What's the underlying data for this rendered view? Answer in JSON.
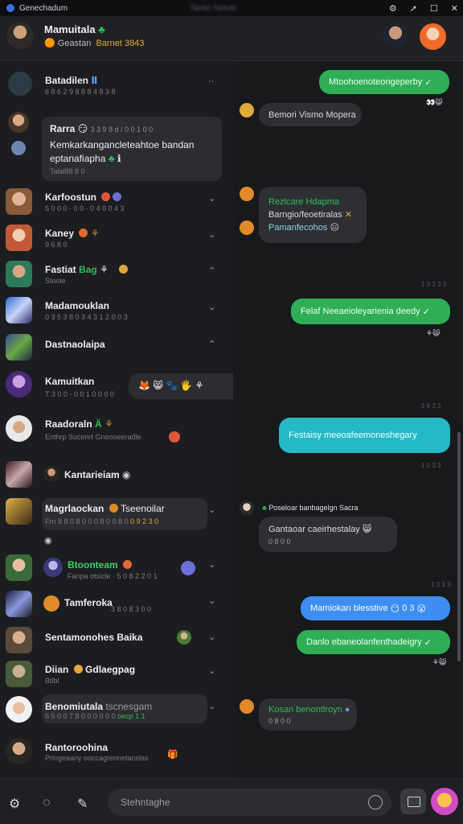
{
  "window": {
    "title": "Genechadum",
    "blurred_center": "Tantie Netute"
  },
  "header": {
    "name": "Mamuitala",
    "name_badge": "♣",
    "status": "Geastan",
    "status_note": "Barnet 3843"
  },
  "conversations": [
    {
      "title": "Batadilen",
      "tag": "Ⅱ",
      "meta": "6 8 6 2 9 8 8 8 4 8 3 8",
      "type": "group"
    },
    {
      "title": "Rarra",
      "time": "3 3 9 8 d / 0 0 1 0 0",
      "text1": "Kemkarkangancleteahtoe bandan",
      "text2": "eptanafiapha",
      "meta": "Talal88 8 0"
    },
    {
      "title": "Karfoostun",
      "meta": "5 0 0 0 - 0 0 - 0 4 0 0 4 3"
    },
    {
      "title": "Kaney",
      "meta": "9 6 8 0"
    },
    {
      "title": "Fastiat",
      "highlight": "Bag",
      "meta": "Stoole"
    },
    {
      "title": "Madamouklan",
      "meta": "0 3 5 3 8 0 3 4 3 1 2 0 0 3"
    },
    {
      "title": "Dastnaolaipa",
      "meta": ""
    },
    {
      "title": "Kamuitkan",
      "meta": "T 3 0 0 - 0 0 1 0 0 0 0",
      "reactions": "🦊 😸 🐾 🖐 ⚘"
    },
    {
      "title": "Raadoraln",
      "highlight": "Ä",
      "meta": "Enthrp Sucenrt Gneooeeradle"
    },
    {
      "title": "Kantarieiam",
      "meta": ""
    },
    {
      "title": "Magrlaockan",
      "extra": "Tseenoilar",
      "meta": "Frn 8 8 0 8 0 0 0 8 0 0 8 0",
      "meta_accent": "0 9 2 3 0"
    },
    {
      "title": "Btoonteam",
      "meta": "Fanpa otsicle · 5 0 8 2 2 0 1"
    },
    {
      "title": "Tamferoka",
      "meta": "3 8 0 8 3 0 0"
    },
    {
      "title": "Sentamonohes Baika",
      "meta": ""
    },
    {
      "title": "Diian",
      "extra": "Gdlaegpag",
      "meta": "Btlbl"
    },
    {
      "title": "Benomiutala",
      "extra": "tscnesgam",
      "meta": "5 5 0 0 7 8 0 0 0 0 0 0",
      "meta_accent": "oecp 1 1"
    },
    {
      "title": "Rantoroohina",
      "meta": "Pringeaany ooccagreonetacelas"
    }
  ],
  "messages": [
    {
      "text": "Mtoohoenoteongeperby",
      "style": "green",
      "check": "✓"
    },
    {
      "text": "Bemori Vismo Mopera",
      "style": "gray"
    },
    {
      "line1": "Rezlcare Hdapma",
      "line2": "Barngio/feoetiralas",
      "line3": "Pamanfecohos",
      "style": "gray"
    },
    {
      "text": "Felaf Neeaeioleyarienia deedy",
      "style": "green",
      "check": "✓",
      "time": "3 8 3 3"
    },
    {
      "text": "Festaisy meeoafeemoneshegary",
      "style": "teal",
      "time": "3 8 3 3"
    },
    {
      "sender": "Poseloar banbagelgn",
      "sender_tag": "Sacra",
      "line1": "Gantaoar caeirhestalay",
      "line2": "0 8 0 0",
      "style": "gray"
    },
    {
      "text": "Mamiokan blesstive",
      "style": "blue",
      "suffix": "0 3",
      "time": "1 3 3 3"
    },
    {
      "text": "Danlo ebaneolanfenthadeigry",
      "style": "green",
      "check": "✓"
    },
    {
      "line1": "Kosan benontlroyn",
      "line2": "0 8 0 0",
      "style": "gray"
    }
  ],
  "timestamps": [
    "1 3 2 3 3",
    "3 8 3 3",
    "1 0 3 3"
  ],
  "composer": {
    "placeholder": "Stehntaghe"
  },
  "colors": {
    "bg": "#1a1b1e",
    "accent_green": "#2fae56",
    "accent_teal": "#23b9c6",
    "accent_blue": "#3d8ef0"
  }
}
